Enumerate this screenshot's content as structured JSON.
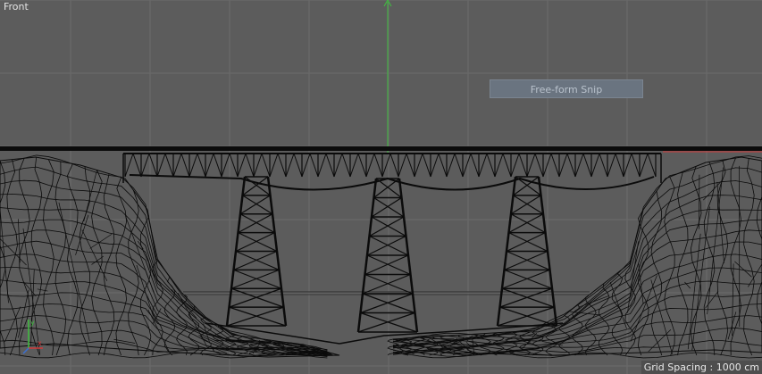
{
  "viewport": {
    "view_name": "Front",
    "grid_spacing_text": "Grid Spacing : 1000 cm",
    "overlay_label": "Free-form Snip"
  },
  "colors": {
    "background": "#5c5c5c",
    "grid": "#6b6b6b",
    "wire": "#0b0b0b",
    "y_axis": "#3fbf3f",
    "x_axis": "#d23a3a",
    "z_axis": "#3a6fd2"
  },
  "icons": {
    "axis_gizmo": "xyz-axis-icon"
  }
}
